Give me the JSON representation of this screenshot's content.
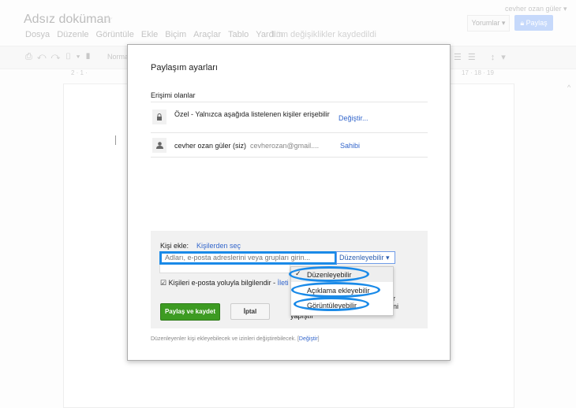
{
  "doc": {
    "title": "Adsız doküman",
    "menu": [
      "Dosya",
      "Düzenle",
      "Görüntüle",
      "Ekle",
      "Biçim",
      "Araçlar",
      "Tablo",
      "Yardım"
    ],
    "save_status": "Tüm değişiklikler kaydedildi",
    "user": "cevher ozan güler ▾",
    "comments_label": "Yorumlar ▾",
    "share_label": "Paylaş",
    "style_label": "Norma",
    "ruler_left": "2 · 1 ·",
    "ruler_right": "17 · 18 · 19"
  },
  "dialog": {
    "title": "Paylaşım ayarları",
    "access_heading": "Erişimi olanlar",
    "rows": [
      {
        "icon": "lock-icon",
        "text": "Özel - Yalnızca aşağıda listelenen kişiler erişebilir",
        "action": "Değiştir..."
      },
      {
        "icon": "person-icon",
        "text": "cevher ozan güler (siz)",
        "email": "cevherozan@gmail....",
        "action": "Sahibi"
      }
    ],
    "add_label": "Kişi ekle:",
    "choose_contacts": "Kişilerden seç",
    "input_placeholder": "Adları, e-posta adreslerini veya grupları girin...",
    "permission_selected": "Düzenleyebilir",
    "permission_options": [
      "Düzenleyebilir",
      "Açıklama ekleyebilir",
      "Görüntüleyebilir"
    ],
    "notify_label": "Kişileri e-posta yoluyla bilgilendir -",
    "notify_link": "İleti",
    "hidden_fragments": [
      "r",
      "ni",
      "yapıştır"
    ],
    "share_save": "Paylaş ve kaydet",
    "cancel": "İptal",
    "footer": "Düzenleyenler kişi ekleyebilecek ve izinleri değiştirebilecek.",
    "footer_link": "Değiştir",
    "accent": "#1a8ae8"
  }
}
